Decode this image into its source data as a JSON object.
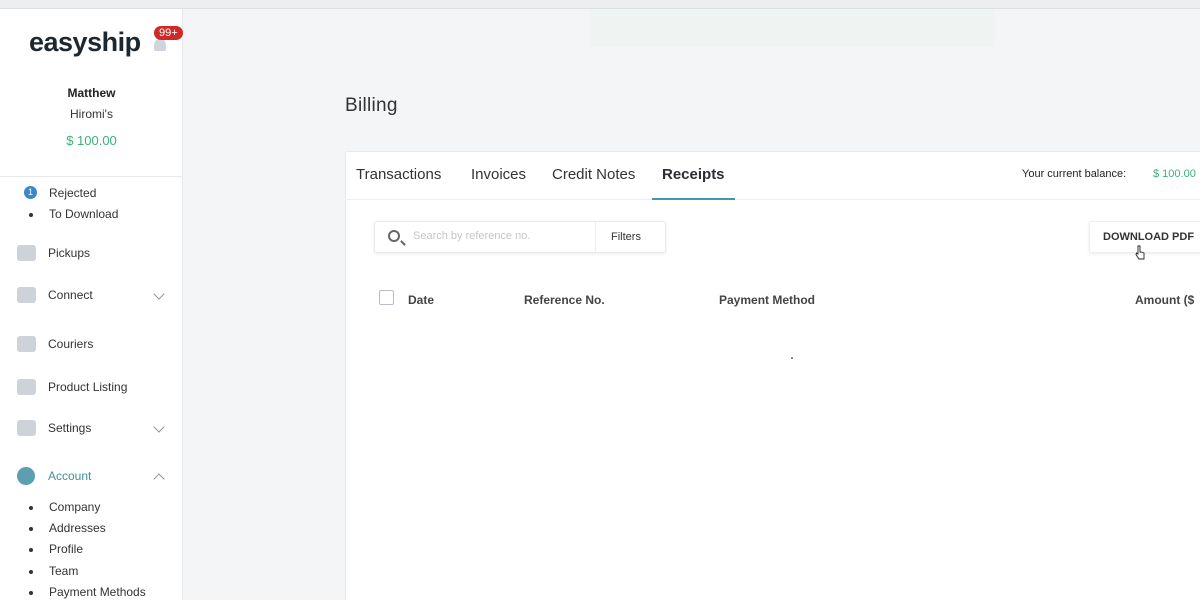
{
  "brand": {
    "logo": "easyship",
    "badge": "99+"
  },
  "user": {
    "name": "Matthew",
    "company": "Hiromi's",
    "balance": "$ 100.00"
  },
  "sidebar": {
    "sub_items_top": [
      {
        "label": "Rejected",
        "count": "1"
      },
      {
        "label": "To Download"
      }
    ],
    "items": [
      {
        "label": "Pickups",
        "icon": "truck-icon"
      },
      {
        "label": "Connect",
        "icon": "hand-icon",
        "expandable": true
      },
      {
        "label": "Couriers",
        "icon": "courier-icon"
      },
      {
        "label": "Product Listing",
        "icon": "box-icon"
      },
      {
        "label": "Settings",
        "icon": "settings-icon",
        "expandable": true
      },
      {
        "label": "Account",
        "icon": "account-icon",
        "expanded": true
      }
    ],
    "account_sub_items": [
      "Company",
      "Addresses",
      "Profile",
      "Team",
      "Payment Methods"
    ]
  },
  "page": {
    "title": "Billing"
  },
  "tabs": [
    "Transactions",
    "Invoices",
    "Credit Notes",
    "Receipts"
  ],
  "active_tab": "Receipts",
  "balance": {
    "label": "Your current balance:",
    "value": "$ 100.00"
  },
  "search": {
    "placeholder": "Search by reference no.",
    "filters_label": "Filters"
  },
  "download": {
    "label": "DOWNLOAD PDF"
  },
  "table": {
    "columns": [
      "Date",
      "Reference No.",
      "Payment Method",
      "Amount ($"
    ]
  },
  "colors": {
    "accent": "#3f9aa6",
    "money": "#3bb07a",
    "badge": "#cf2a2a"
  }
}
